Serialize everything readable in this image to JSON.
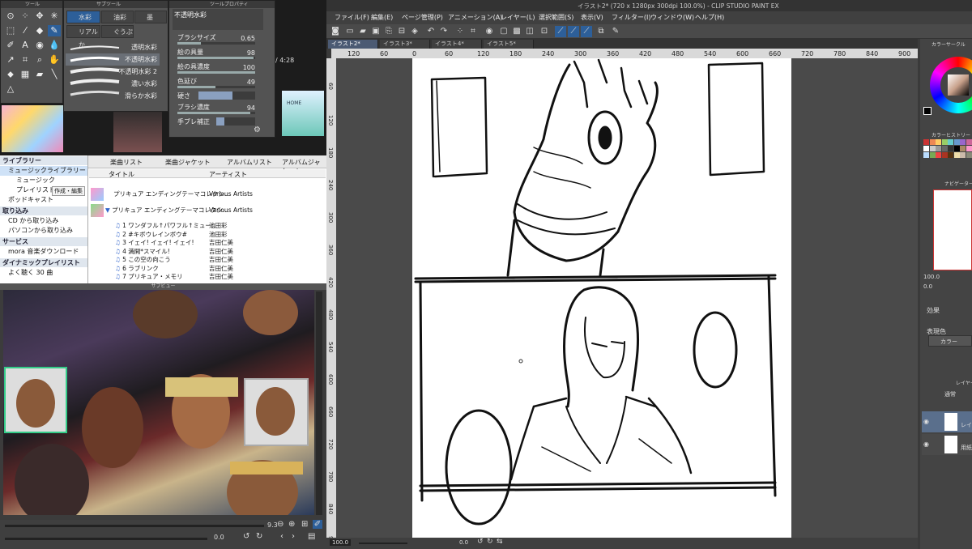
{
  "subtool_window": {
    "title_tool": "ツール",
    "title_subtool": "サブツール",
    "tabs": [
      "水彩",
      "油彩",
      "墨",
      "リアルか",
      "ぐうぷ"
    ],
    "brushes": [
      "透明水彩",
      "不透明水彩",
      "不透明水彩 2",
      "濃い水彩",
      "滑らか水彩"
    ],
    "selected_brush": "不透明水彩"
  },
  "tool_property": {
    "title": "ツールプロパティ",
    "brush_name": "不透明水彩",
    "props": [
      {
        "label": "ブラシサイズ",
        "value": "0.65",
        "fill": 0.3
      },
      {
        "label": "絵の具量",
        "value": "98",
        "fill": 0.98
      },
      {
        "label": "絵の具濃度",
        "value": "100",
        "fill": 1.0
      },
      {
        "label": "色延び",
        "value": "49",
        "fill": 0.49
      },
      {
        "label": "硬さ",
        "value": "",
        "fill": 0.6
      },
      {
        "label": "ブラシ濃度",
        "value": "94",
        "fill": 0.94
      },
      {
        "label": "手ブレ補正",
        "value": "",
        "fill": 0.2
      }
    ]
  },
  "player": {
    "time": "/ 4:28",
    "thumb2_text": "HOME"
  },
  "library": {
    "top_tabs": [
      "楽曲リスト",
      "楽曲ジャケット",
      "アルバムリスト",
      "アルバムジャケット"
    ],
    "sections": [
      {
        "header": "ライブラリー",
        "items": [
          "ミュージックライブラリー",
          "ミュージック",
          "プレイリスト",
          "ポッドキャスト"
        ]
      },
      {
        "header": "取り込み",
        "items": [
          "CD から取り込み",
          "パソコンから取り込み"
        ]
      },
      {
        "header": "サービス",
        "items": [
          "mora 音楽ダウンロード"
        ]
      },
      {
        "header": "ダイナミックプレイリスト",
        "items": [
          "よく聴く 30 曲"
        ]
      }
    ],
    "edit_button": "作成・編集",
    "columns": [
      "タイトル",
      "アーティスト"
    ],
    "albums": [
      {
        "title": "プリキュア エンディングテーマコレクシ...",
        "artist": "Various Artists"
      },
      {
        "title": "プリキュア エンディングテーマコレクシ...",
        "artist": "Various Artists"
      }
    ],
    "tracks": [
      {
        "no": "1",
        "title": "ワンダフル↑パワフル↑ミュー...",
        "artist": "池田彩"
      },
      {
        "no": "2",
        "title": "#キボウレインボウ#",
        "artist": "池田彩"
      },
      {
        "no": "3",
        "title": "イェイ! イェイ! イェイ!",
        "artist": "吉田仁美"
      },
      {
        "no": "4",
        "title": "満開*スマイル!",
        "artist": "吉田仁美"
      },
      {
        "no": "5",
        "title": "この空の向こう",
        "artist": "吉田仁美"
      },
      {
        "no": "6",
        "title": "ラブリンク",
        "artist": "吉田仁美"
      },
      {
        "no": "7",
        "title": "プリキュア・メモリ",
        "artist": "吉田仁美"
      }
    ]
  },
  "preview": {
    "title": "サブビュー",
    "zoom": "9.3",
    "bottom_value": "0.0"
  },
  "app": {
    "title": "イラスト2* (720 x 1280px 300dpi 100.0%) - CLIP STUDIO PAINT EX",
    "menus": [
      "ファイル(F)",
      "編集(E)",
      "ページ管理(P)",
      "アニメーション(A)",
      "レイヤー(L)",
      "選択範囲(S)",
      "表示(V)",
      "フィルター(I)",
      "ウィンドウ(W)",
      "ヘルプ(H)"
    ],
    "tabs": [
      "イラスト2*",
      "イラスト3*",
      "イラスト4*",
      "イラスト5*"
    ],
    "ruler_ticks": [
      "120",
      "60",
      "0",
      "60",
      "120",
      "180",
      "240",
      "300",
      "360",
      "420",
      "480",
      "540",
      "600",
      "660",
      "720",
      "780",
      "840",
      "900"
    ],
    "vruler_ticks": [
      "60",
      "120",
      "180",
      "240",
      "300",
      "360",
      "420",
      "480",
      "540",
      "600",
      "660",
      "720",
      "780",
      "840",
      "900"
    ],
    "status_zoom": "100.0",
    "status_angle": "0.0"
  },
  "right_panel": {
    "color_wheel_title": "カラーサークル",
    "history_title": "カラーヒストリー",
    "navigator_title": "ナビゲーター",
    "zoom": "100.0",
    "angle": "0.0",
    "effect_label": "効果",
    "expression_label": "表現色",
    "expression_value": "カラー",
    "layer_title": "レイヤー",
    "blend_mode": "通常",
    "opacity": "100",
    "layer_name": "レイ",
    "paper_label": "用紙"
  },
  "colors": {
    "accent": "#2d5f99",
    "panel": "#535353",
    "canvas": "#ffffff"
  }
}
